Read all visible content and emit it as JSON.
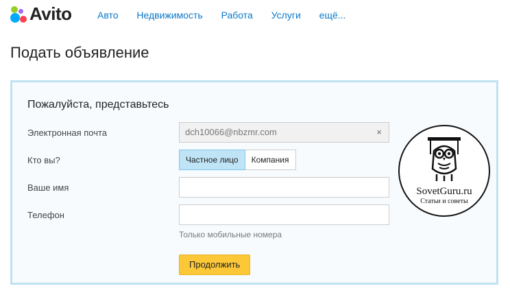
{
  "header": {
    "logo_text": "Avito",
    "nav": [
      "Авто",
      "Недвижимость",
      "Работа",
      "Услуги",
      "ещё..."
    ]
  },
  "page_title": "Подать объявление",
  "form": {
    "title": "Пожалуйста, представьтесь",
    "email_label": "Электронная почта",
    "email_value": "dch10066@nbzmr.com",
    "clear_symbol": "×",
    "who_label": "Кто вы?",
    "who_options": [
      "Частное лицо",
      "Компания"
    ],
    "who_selected": "Частное лицо",
    "name_label": "Ваше имя",
    "name_value": "",
    "phone_label": "Телефон",
    "phone_value": "",
    "phone_hint": "Только мобильные номера",
    "submit_label": "Продолжить"
  },
  "watermark": {
    "name": "SovetGuru.ru",
    "subtitle": "Статьи и советы"
  },
  "colors": {
    "link": "#0a77c9",
    "panel_border": "#bfe2f1",
    "active_segment": "#bfe4f6",
    "submit": "#fcc838"
  }
}
